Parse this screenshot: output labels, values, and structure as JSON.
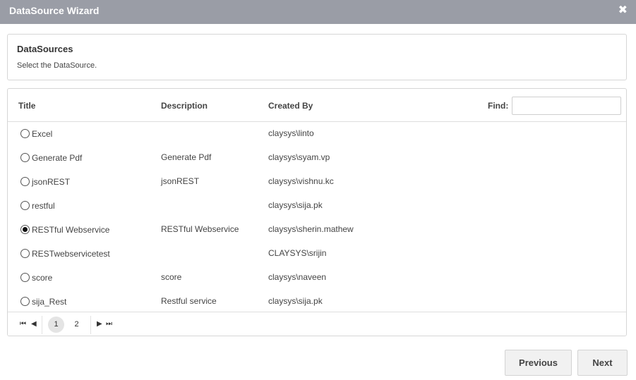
{
  "window": {
    "title": "DataSource Wizard",
    "close_glyph": "✖"
  },
  "info": {
    "heading": "DataSources",
    "subtitle": "Select the DataSource."
  },
  "grid": {
    "columns": {
      "title": "Title",
      "description": "Description",
      "created_by": "Created By"
    },
    "find": {
      "label": "Find:",
      "value": ""
    },
    "rows": [
      {
        "title": "Excel",
        "description": "",
        "created_by": "claysys\\linto",
        "selected": false
      },
      {
        "title": "Generate Pdf",
        "description": "Generate Pdf",
        "created_by": "claysys\\syam.vp",
        "selected": false
      },
      {
        "title": "jsonREST",
        "description": "jsonREST",
        "created_by": "claysys\\vishnu.kc",
        "selected": false
      },
      {
        "title": "restful",
        "description": "",
        "created_by": "claysys\\sija.pk",
        "selected": false
      },
      {
        "title": "RESTful Webservice",
        "description": "RESTful Webservice",
        "created_by": "claysys\\sherin.mathew",
        "selected": true
      },
      {
        "title": "RESTwebservicetest",
        "description": "",
        "created_by": "CLAYSYS\\srijin",
        "selected": false
      },
      {
        "title": "score",
        "description": "score",
        "created_by": "claysys\\naveen",
        "selected": false
      },
      {
        "title": "sija_Rest",
        "description": "Restful service",
        "created_by": "claysys\\sija.pk",
        "selected": false
      }
    ]
  },
  "pager": {
    "first_glyph": "⏮",
    "prev_glyph": "◀",
    "next_glyph": "▶",
    "last_glyph": "⏭",
    "pages": [
      "1",
      "2"
    ],
    "current_page": "1"
  },
  "buttons": {
    "previous": "Previous",
    "next": "Next"
  }
}
